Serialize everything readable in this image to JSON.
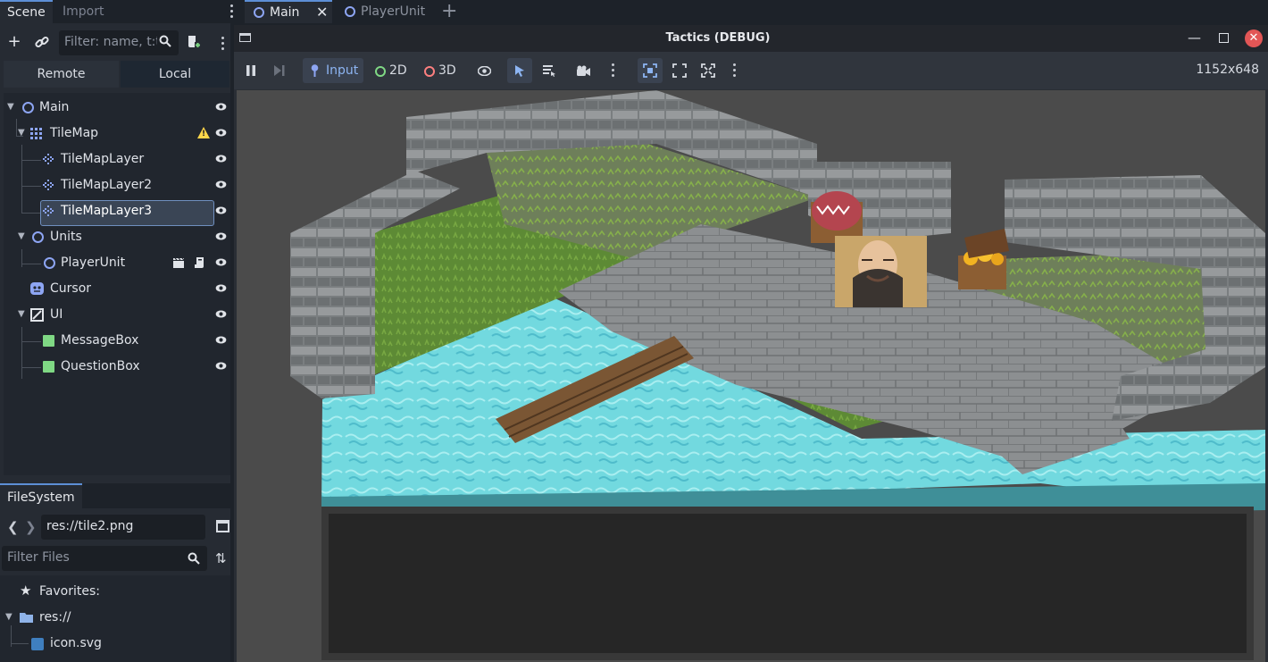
{
  "left_dock": {
    "tabs": [
      "Scene",
      "Import"
    ],
    "filter_placeholder": "Filter: name, t:t",
    "remote_label": "Remote",
    "local_label": "Local",
    "tree": [
      {
        "label": "Main",
        "type": "node"
      },
      {
        "label": "TileMap",
        "type": "tilemap",
        "warning": true
      },
      {
        "label": "TileMapLayer",
        "type": "tilemaplayer"
      },
      {
        "label": "TileMapLayer2",
        "type": "tilemaplayer"
      },
      {
        "label": "TileMapLayer3",
        "type": "tilemaplayer",
        "selected": true
      },
      {
        "label": "Units",
        "type": "node"
      },
      {
        "label": "PlayerUnit",
        "type": "node"
      },
      {
        "label": "Cursor",
        "type": "sprite"
      },
      {
        "label": "UI",
        "type": "canvaslayer"
      },
      {
        "label": "MessageBox",
        "type": "control"
      },
      {
        "label": "QuestionBox",
        "type": "control"
      }
    ]
  },
  "filesystem": {
    "tab": "FileSystem",
    "path": "res://tile2.png",
    "filter_placeholder": "Filter Files",
    "items": [
      {
        "label": "Favorites:"
      },
      {
        "label": "res://"
      },
      {
        "label": "icon.svg"
      }
    ]
  },
  "editor_tabs": [
    {
      "label": "Main",
      "active": true
    },
    {
      "label": "PlayerUnit",
      "active": false
    }
  ],
  "game_window": {
    "title": "Tactics (DEBUG)",
    "toolbar": {
      "input_label": "Input",
      "label_2d": "2D",
      "label_3d": "3D",
      "resolution": "1152x648"
    }
  },
  "colors": {
    "accent": "#5d8fd6",
    "node_icon": "#8da5f3",
    "warning": "#ffd74a",
    "close_button": "#e25656",
    "water": "#6fd8e0",
    "grass": "#5f8a34",
    "stone": "#8a8d8f"
  }
}
